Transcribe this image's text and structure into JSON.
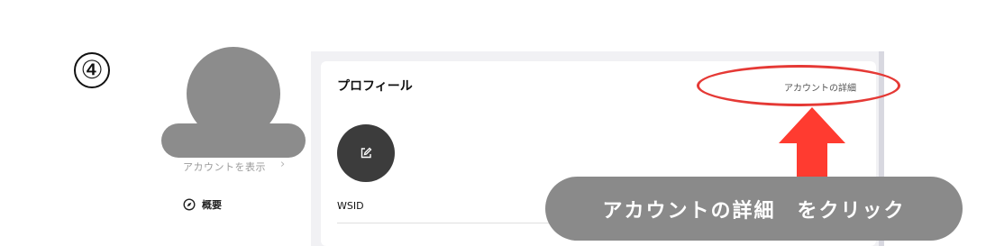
{
  "step_marker": "④",
  "sidebar": {
    "view_account_label": "アカウントを表示",
    "view_account_chevron": "›",
    "nav_items": [
      {
        "label": "概要",
        "icon": "compass-icon"
      }
    ]
  },
  "profile": {
    "title": "プロフィール",
    "account_detail_link": "アカウントの詳細",
    "avatar_icon": "edit-icon",
    "wsid_label": "WSID"
  },
  "annotation": {
    "callout_text": "アカウントの詳細　をクリック",
    "highlight_color": "#e53935",
    "arrow_color": "#ff3b30",
    "callout_bg": "#8a8a8a"
  }
}
